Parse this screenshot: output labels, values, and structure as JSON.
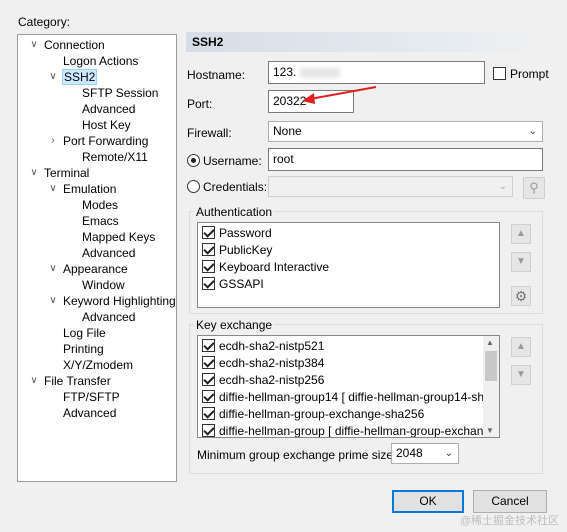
{
  "category_label": "Category:",
  "tree": [
    {
      "label": "Connection",
      "toggle": "expanded"
    },
    {
      "label": "Logon Actions",
      "toggle": ""
    },
    {
      "label": "SSH2",
      "toggle": "expanded",
      "selected": true
    },
    {
      "label": "SFTP Session",
      "toggle": ""
    },
    {
      "label": "Advanced",
      "toggle": ""
    },
    {
      "label": "Host Key",
      "toggle": ""
    },
    {
      "label": "Port Forwarding",
      "toggle": "collapsed"
    },
    {
      "label": "Remote/X11",
      "toggle": ""
    },
    {
      "label": "Terminal",
      "toggle": "expanded"
    },
    {
      "label": "Emulation",
      "toggle": "expanded"
    },
    {
      "label": "Modes",
      "toggle": ""
    },
    {
      "label": "Emacs",
      "toggle": ""
    },
    {
      "label": "Mapped Keys",
      "toggle": ""
    },
    {
      "label": "Advanced",
      "toggle": ""
    },
    {
      "label": "Appearance",
      "toggle": "expanded"
    },
    {
      "label": "Window",
      "toggle": ""
    },
    {
      "label": "Keyword Highlighting",
      "toggle": "expanded"
    },
    {
      "label": "Advanced",
      "toggle": ""
    },
    {
      "label": "Log File",
      "toggle": ""
    },
    {
      "label": "Printing",
      "toggle": ""
    },
    {
      "label": "X/Y/Zmodem",
      "toggle": ""
    },
    {
      "label": "File Transfer",
      "toggle": "expanded"
    },
    {
      "label": "FTP/SFTP",
      "toggle": ""
    },
    {
      "label": "Advanced",
      "toggle": ""
    }
  ],
  "section_title": "SSH2",
  "hostname": {
    "label": "Hostname:",
    "value": "123."
  },
  "prompt_label": "Prompt",
  "port": {
    "label": "Port:",
    "value": "20322"
  },
  "firewall": {
    "label": "Firewall:",
    "value": "None"
  },
  "username": {
    "label": "Username:",
    "value": "root"
  },
  "credentials": {
    "label": "Credentials:",
    "value": ""
  },
  "authentication": {
    "title": "Authentication",
    "items": [
      "Password",
      "PublicKey",
      "Keyboard Interactive",
      "GSSAPI"
    ]
  },
  "key_exchange": {
    "title": "Key exchange",
    "items": [
      "ecdh-sha2-nistp521",
      "ecdh-sha2-nistp384",
      "ecdh-sha2-nistp256",
      "diffie-hellman-group14 [ diffie-hellman-group14-sh...",
      "diffie-hellman-group-exchange-sha256",
      "diffie-hellman-group [ diffie-hellman-group-exchan..."
    ]
  },
  "min_group": {
    "label": "Minimum group exchange prime size:",
    "value": "2048"
  },
  "ok_label": "OK",
  "cancel_label": "Cancel",
  "watermark": "@稀土掘金技术社区",
  "colors": {
    "accent": "#0078d7",
    "arrow": "#e02020",
    "selection": "#cce8ff"
  }
}
